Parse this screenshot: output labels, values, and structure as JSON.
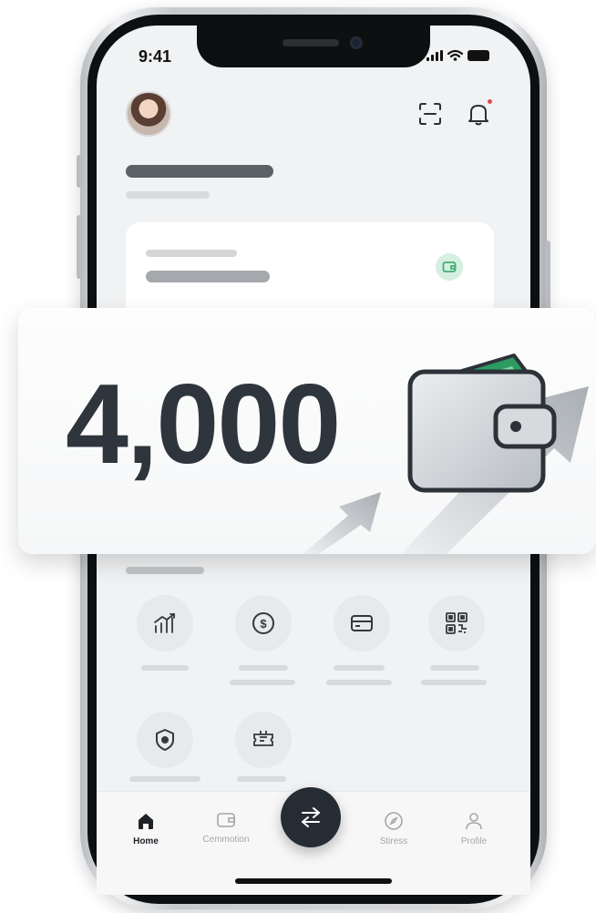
{
  "status_bar": {
    "time": "9:41"
  },
  "header": {
    "avatar_icon": "user-avatar",
    "scan_icon": "scan-frame-icon",
    "bell_icon": "bell-icon",
    "has_notification": true
  },
  "overlay": {
    "amount": "4,000",
    "wallet_icon": "wallet-icon"
  },
  "quick_actions": [
    {
      "icon": "chart-growth-icon"
    },
    {
      "icon": "dollar-circle-icon"
    },
    {
      "icon": "card-icon"
    },
    {
      "icon": "qr-code-icon"
    },
    {
      "icon": "shield-badge-icon"
    },
    {
      "icon": "ticket-icon"
    }
  ],
  "tab_bar": {
    "tabs": [
      {
        "label": "Home",
        "icon": "home-icon",
        "active": true
      },
      {
        "label": "Cemmotion",
        "icon": "wallet-outline-icon",
        "active": false
      },
      {
        "label": "Stiress",
        "icon": "compass-icon",
        "active": false
      },
      {
        "label": "Profile",
        "icon": "person-icon",
        "active": false
      }
    ],
    "center_action_icon": "swap-arrows-icon"
  },
  "colors": {
    "accent_dark": "#262c33",
    "amount_text": "#2f353c",
    "notification": "#e8484f",
    "wallet_green": "#3fae74"
  }
}
